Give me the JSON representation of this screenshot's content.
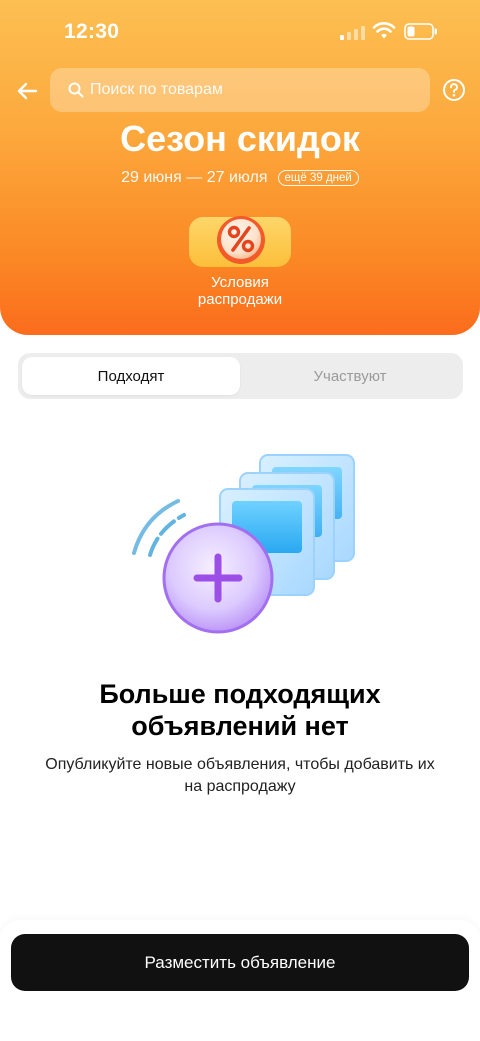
{
  "status_bar": {
    "time": "12:30"
  },
  "header": {
    "search_placeholder": "Поиск по товарам",
    "title": "Сезон скидок",
    "dates": "29 июня — 27 июля",
    "days_left": "ещё 39 дней",
    "conditions_label": "Условия распродажи"
  },
  "tabs": {
    "items": [
      {
        "label": "Подходят",
        "active": true
      },
      {
        "label": "Участвуют",
        "active": false
      }
    ]
  },
  "empty_state": {
    "title": "Больше подходящих объявлений нет",
    "description": "Опубликуйте новые объявления, чтобы добавить их на распродажу"
  },
  "footer": {
    "post_button": "Разместить объявление"
  },
  "icons": [
    "back-arrow-icon",
    "search-icon",
    "help-icon",
    "signal-icon",
    "wifi-icon",
    "battery-icon",
    "percent-icon"
  ],
  "colors": {
    "hero_top": "#fdbf52",
    "hero_bottom": "#fb6c1c",
    "button_bg": "#111111",
    "tab_bg": "#ededed"
  }
}
